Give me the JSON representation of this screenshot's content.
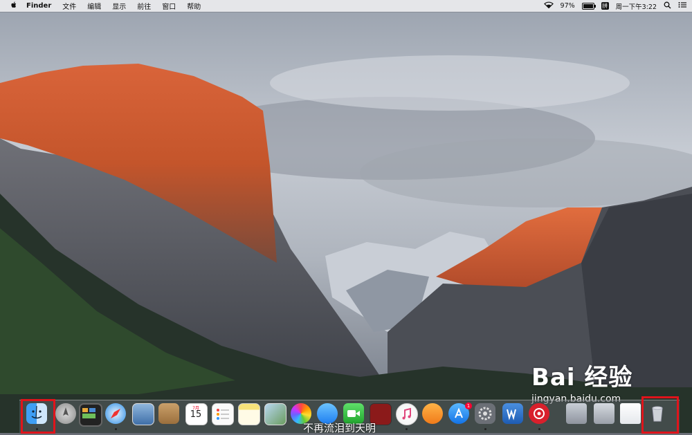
{
  "menubar": {
    "app_name": "Finder",
    "menus": [
      "文件",
      "编辑",
      "显示",
      "前往",
      "窗口",
      "帮助"
    ],
    "battery_percent": "97%",
    "battery_level": 0.97,
    "input_method": "拼",
    "clock": "周一下午3:22"
  },
  "dock": {
    "items": [
      "finder-icon",
      "launchpad-icon",
      "mission-control-icon",
      "safari-icon",
      "preview-icon",
      "contacts-icon",
      "calendar-icon",
      "reminders-icon",
      "notes-icon",
      "preview-photos-icon",
      "photos-icon",
      "messages-icon",
      "facetime-icon",
      "photo-booth-icon",
      "itunes-icon",
      "ibooks-icon",
      "app-store-icon",
      "system-preferences-icon",
      "word-icon",
      "netease-music-icon",
      "folder-icon",
      "downloads-icon",
      "document-icon",
      "trash-icon"
    ],
    "calendar_month": "7月",
    "calendar_day": "15",
    "app_store_badge": "1"
  },
  "subtitle": "不再流泪到天明",
  "watermark": {
    "brand": "Bai 经验",
    "url": "jingyan.baidu.com"
  },
  "colors": {
    "highlight": "#e0141b",
    "menubar_bg": "#ececee"
  }
}
